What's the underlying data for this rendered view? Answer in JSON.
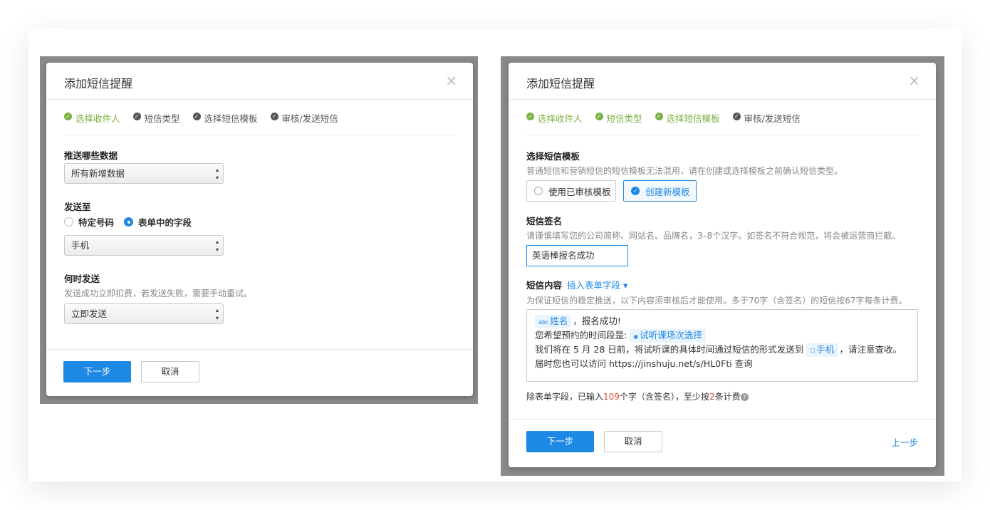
{
  "left": {
    "title": "添加短信提醒",
    "close": "×",
    "steps": [
      {
        "label": "选择收件人",
        "done": true
      },
      {
        "label": "短信类型",
        "done": false
      },
      {
        "label": "选择短信模板",
        "done": false
      },
      {
        "label": "审核/发送短信",
        "done": false
      }
    ],
    "push_label": "推送哪些数据",
    "push_select": "所有新增数据",
    "send_to_label": "发送至",
    "radio_specific": "特定号码",
    "radio_field": "表单中的字段",
    "field_select": "手机",
    "when_label": "何时发送",
    "when_hint": "发送成功立即扣费，若发送失败，需要手动重试。",
    "when_select": "立即发送",
    "next": "下一步",
    "cancel": "取消"
  },
  "right": {
    "title": "添加短信提醒",
    "close": "×",
    "steps": [
      {
        "label": "选择收件人",
        "done": true
      },
      {
        "label": "短信类型",
        "done": true
      },
      {
        "label": "选择短信模板",
        "done": true
      },
      {
        "label": "审核/发送短信",
        "done": false
      }
    ],
    "template_label": "选择短信模板",
    "template_hint": "普通短信和营销短信的短信模板无法混用，请在创建或选择模板之前确认短信类型。",
    "choice_existing": "使用已审核模板",
    "choice_new": "创建新模板",
    "sign_label": "短信签名",
    "sign_hint": "请谨慎填写您的公司简称、网站名、品牌名，3–8个汉字。如签名不符合规范，将会被运营商拦截。",
    "sign_value": "英语棒报名成功",
    "content_label": "短信内容",
    "insert_field": "插入表单字段 ▾",
    "content_hint": "为保证短信的稳定推送，以下内容须审核后才能使用。多于70字（含签名）的短信按67字每条计费。",
    "body": {
      "tag_name_icon": "abc",
      "tag_name": "姓名",
      "line1_after": "，报名成功!",
      "line2_before": "您希望预约的时间段是:",
      "tag_time": "试听课场次选择",
      "line3_before": "我们将在 5 月 28 日前，将试听课的具体时间通过短信的形式发送到",
      "tag_phone": "手机",
      "line3_after": "，请注意查收。",
      "line4": "届时您也可以访问 https://jinshuju.net/s/HL0Fti 查询"
    },
    "count_prefix": "除表单字段，已输入",
    "count_chars": "109",
    "count_mid": "个字（含签名），至少按",
    "count_msgs": "2",
    "count_suffix": "条计费",
    "next": "下一步",
    "cancel": "取消",
    "prev": "上一步"
  },
  "colors": {
    "primary": "#1e88e5",
    "done": "#7bb042",
    "warn": "#e0493c"
  }
}
